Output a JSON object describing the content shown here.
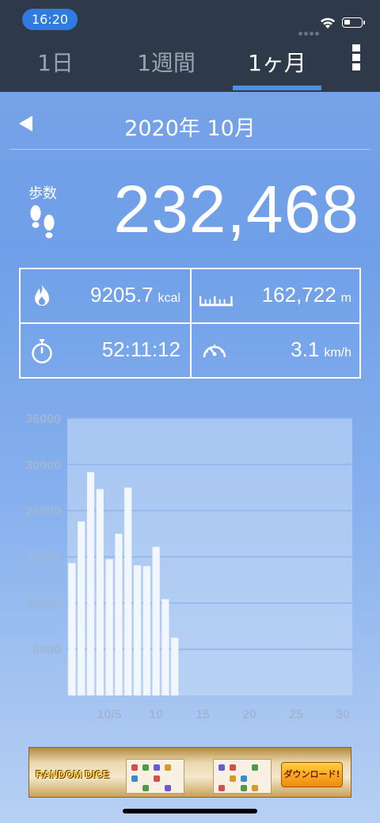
{
  "status_bar": {
    "time": "16:20"
  },
  "tabs": [
    {
      "label": "1日",
      "active": false
    },
    {
      "label": "1週間",
      "active": false
    },
    {
      "label": "1ヶ月",
      "active": true
    }
  ],
  "month_nav": {
    "title": "2020年 10月"
  },
  "steps": {
    "label": "歩数",
    "value": "232,468"
  },
  "stats": {
    "calories": {
      "value": "9205.7",
      "unit": "kcal",
      "icon": "flame-icon"
    },
    "distance": {
      "value": "162,722",
      "unit": "m",
      "icon": "ruler-icon"
    },
    "duration": {
      "value": "52:11:12",
      "unit": "",
      "icon": "stopwatch-icon"
    },
    "speed": {
      "value": "3.1",
      "unit": "km/h",
      "icon": "speedometer-icon"
    }
  },
  "chart_data": {
    "type": "bar",
    "x": [
      1,
      2,
      3,
      4,
      5,
      6,
      7,
      8,
      9,
      10,
      11,
      12
    ],
    "values": [
      17200,
      22600,
      29000,
      26800,
      17700,
      21000,
      27000,
      16900,
      16800,
      19300,
      12500,
      7500
    ],
    "xlim": [
      0.5,
      31
    ],
    "ylim": [
      0,
      36000
    ],
    "y_ticks": [
      "36000",
      "30000",
      "24000",
      "18000",
      "12000",
      "6000"
    ],
    "x_ticks": [
      {
        "x": 5,
        "label": "10/5"
      },
      {
        "x": 10,
        "label": "10"
      },
      {
        "x": 15,
        "label": "15"
      },
      {
        "x": 20,
        "label": "20"
      },
      {
        "x": 25,
        "label": "25"
      },
      {
        "x": 30,
        "label": "30"
      }
    ],
    "grid": true,
    "bar_color": "#f2f7fe"
  },
  "ad": {
    "brand": "RANDOM DICE",
    "cta": "ダウンロード!"
  }
}
